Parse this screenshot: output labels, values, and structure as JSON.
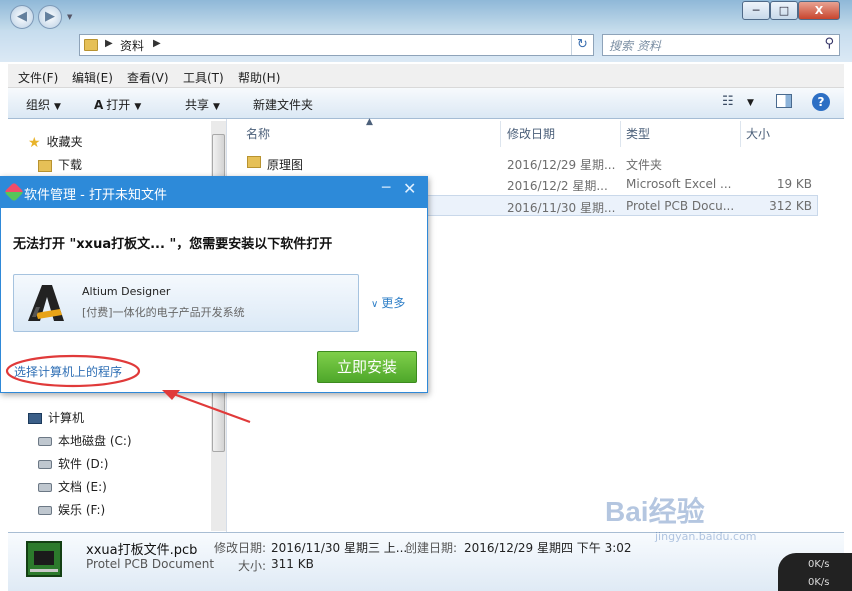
{
  "window": {
    "minimize": "─",
    "maximize": "□",
    "close": "X"
  },
  "address": {
    "crumb": "资料",
    "search_placeholder": "搜索 资料",
    "back": "◀",
    "forward": "▶",
    "refresh": "↻",
    "history": "▼"
  },
  "menubar": [
    "文件(F)",
    "编辑(E)",
    "查看(V)",
    "工具(T)",
    "帮助(H)"
  ],
  "toolbar": {
    "organize": "组织",
    "open": "打开",
    "share": "共享",
    "new_folder": "新建文件夹",
    "help": "?"
  },
  "nav": {
    "favorites": "收藏夹",
    "downloads": "下载",
    "computer": "计算机",
    "drives": [
      "本地磁盘 (C:)",
      "软件 (D:)",
      "文档 (E:)",
      "娱乐 (F:)"
    ]
  },
  "columns": {
    "name": "名称",
    "date": "修改日期",
    "type": "类型",
    "size": "大小"
  },
  "files": [
    {
      "name": "原理图",
      "date": "2016/12/29 星期...",
      "type": "文件夹",
      "size": ""
    },
    {
      "name": "",
      "date": "2016/12/2 星期...",
      "type": "Microsoft Excel ...",
      "size": "19 KB"
    },
    {
      "name": "",
      "date": "2016/11/30 星期...",
      "type": "Protel PCB Docu...",
      "size": "312 KB"
    }
  ],
  "details": {
    "filename": "xxua打板文件.pcb",
    "filetype": "Protel PCB Document",
    "modified_label": "修改日期:",
    "modified": "2016/11/30 星期三 上...",
    "created_label": "创建日期:",
    "created": "2016/12/29 星期四 下午 3:02",
    "size_label": "大小:",
    "size": "311 KB"
  },
  "netmeter": {
    "up": "0K/s",
    "down": "0K/s"
  },
  "watermark": {
    "text": "Bai经验",
    "url": "jingyan.baidu.com"
  },
  "dialog": {
    "title": "软件管理 - 打开未知文件",
    "message": "无法打开 \"xxua打板文...  \"，您需要安装以下软件打开",
    "app_name": "Altium Designer",
    "app_desc": "[付费]一体化的电子产品开发系统",
    "more": "更多",
    "choose_program": "选择计算机上的程序",
    "install": "立即安装"
  },
  "colors": {
    "dialog_header": "#2d8ad9",
    "install_button": "#5cb832",
    "annotation": "#e03a3a",
    "link": "#2f6fb5"
  }
}
